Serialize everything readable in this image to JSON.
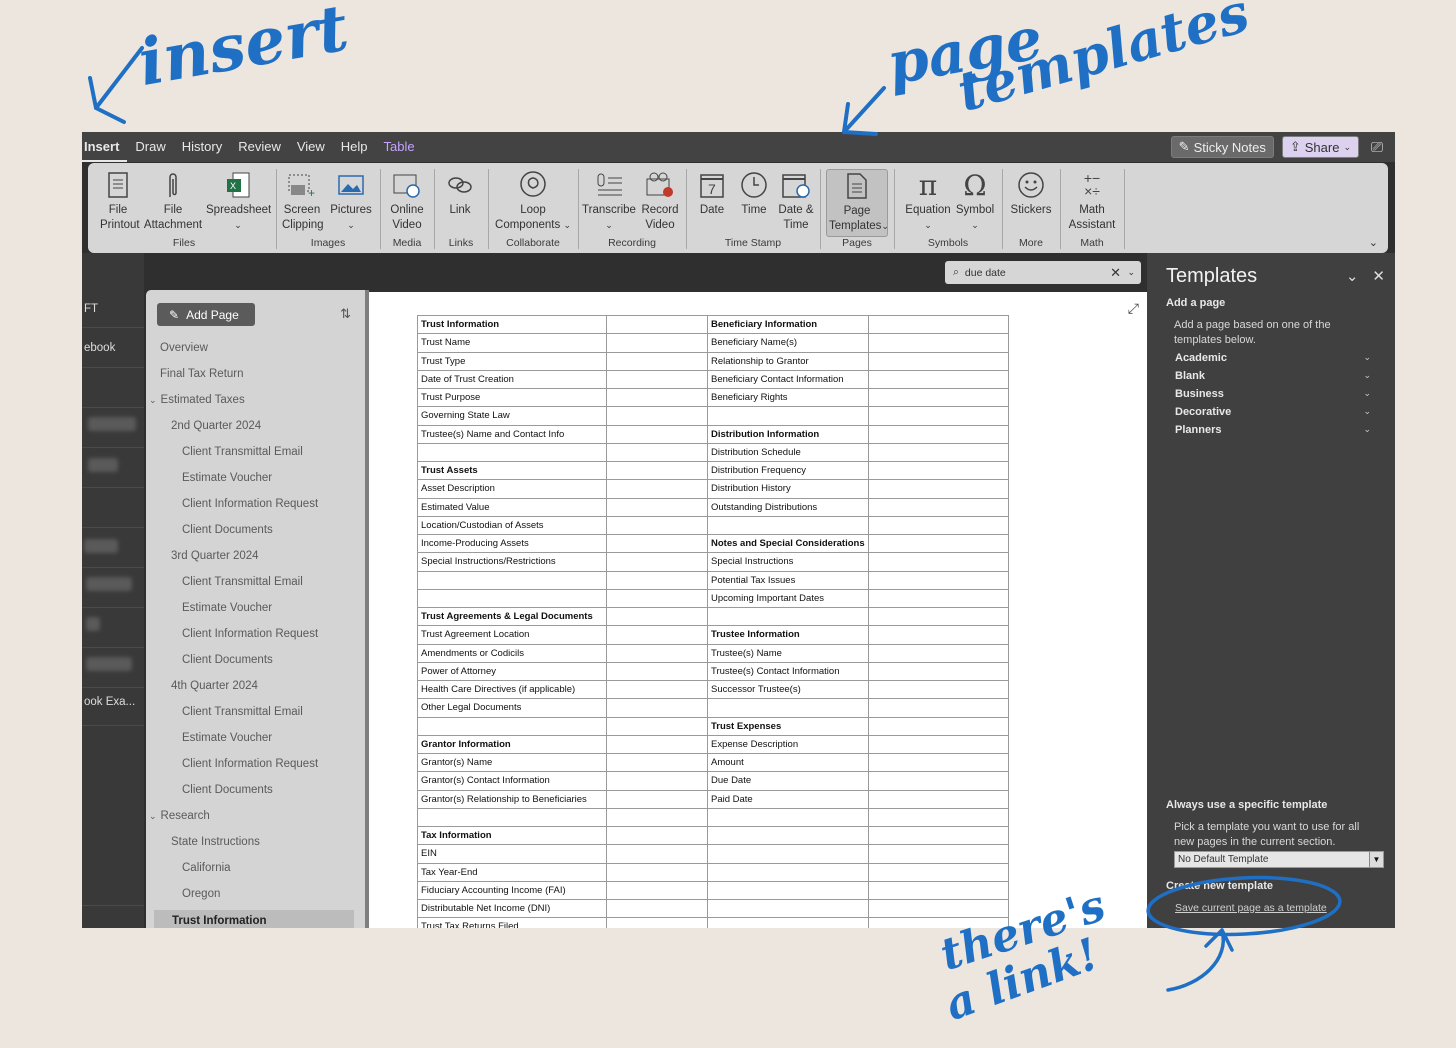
{
  "annotations": {
    "insert": "insert",
    "page_templates_1": "page",
    "page_templates_2": "templates",
    "link_1": "there's",
    "link_2": "a link!"
  },
  "tabs": [
    "Insert",
    "Draw",
    "History",
    "Review",
    "View",
    "Help",
    "Table"
  ],
  "tabs_right": {
    "sticky_notes": "Sticky Notes",
    "share": "Share"
  },
  "ribbon": {
    "groups": {
      "files": "Files",
      "images": "Images",
      "media": "Media",
      "links": "Links",
      "collaborate": "Collaborate",
      "recording": "Recording",
      "time_stamp": "Time Stamp",
      "pages": "Pages",
      "symbols": "Symbols",
      "more": "More",
      "math": "Math"
    },
    "buttons": {
      "file_printout_1": "File",
      "file_printout_2": "Printout",
      "file_attachment_1": "File",
      "file_attachment_2": "Attachment",
      "spreadsheet": "Spreadsheet",
      "screen_clipping_1": "Screen",
      "screen_clipping_2": "Clipping",
      "pictures": "Pictures",
      "online_video_1": "Online",
      "online_video_2": "Video",
      "link": "Link",
      "loop_1": "Loop",
      "loop_2": "Components",
      "transcribe": "Transcribe",
      "record_video_1": "Record",
      "record_video_2": "Video",
      "date": "Date",
      "time": "Time",
      "date_time_1": "Date &",
      "date_time_2": "Time",
      "page_templates_1": "Page",
      "page_templates_2": "Templates",
      "equation": "Equation",
      "symbol": "Symbol",
      "stickers": "Stickers",
      "math_1": "Math",
      "math_2": "Assistant"
    }
  },
  "notebooks": [
    "FT",
    "ebook",
    "ook Exa..."
  ],
  "pagelist": {
    "add_page": "Add Page",
    "pages": [
      {
        "label": "Overview",
        "level": 0
      },
      {
        "label": "Final Tax Return",
        "level": 0
      },
      {
        "label": "Estimated Taxes",
        "level": 0,
        "expanded": true
      },
      {
        "label": "2nd Quarter 2024",
        "level": 1
      },
      {
        "label": "Client Transmittal Email",
        "level": 2
      },
      {
        "label": "Estimate Voucher",
        "level": 2
      },
      {
        "label": "Client Information Request",
        "level": 2
      },
      {
        "label": "Client Documents",
        "level": 2
      },
      {
        "label": "3rd Quarter 2024",
        "level": 1
      },
      {
        "label": "Client Transmittal Email",
        "level": 2
      },
      {
        "label": "Estimate Voucher",
        "level": 2
      },
      {
        "label": "Client Information Request",
        "level": 2
      },
      {
        "label": "Client Documents",
        "level": 2
      },
      {
        "label": "4th Quarter 2024",
        "level": 1
      },
      {
        "label": "Client Transmittal Email",
        "level": 2
      },
      {
        "label": "Estimate Voucher",
        "level": 2
      },
      {
        "label": "Client Information Request",
        "level": 2
      },
      {
        "label": "Client Documents",
        "level": 2
      },
      {
        "label": "Research",
        "level": 0,
        "expanded": true
      },
      {
        "label": "State Instructions",
        "level": 1
      },
      {
        "label": "California",
        "level": 2
      },
      {
        "label": "Oregon",
        "level": 2
      },
      {
        "label": "Trust Information",
        "level": 0,
        "selected": true
      }
    ]
  },
  "search": {
    "value": "due date"
  },
  "table": {
    "rows": [
      [
        "Trust Information",
        "Beneficiary Information"
      ],
      [
        "Trust Name",
        "Beneficiary Name(s)"
      ],
      [
        "Trust Type",
        "Relationship to Grantor"
      ],
      [
        "Date of Trust Creation",
        "Beneficiary Contact Information"
      ],
      [
        "Trust Purpose",
        "Beneficiary Rights"
      ],
      [
        "Governing State Law",
        ""
      ],
      [
        "Trustee(s) Name and Contact Info",
        "Distribution Information"
      ],
      [
        "",
        "Distribution Schedule"
      ],
      [
        "Trust Assets",
        "Distribution Frequency"
      ],
      [
        "Asset Description",
        "Distribution History"
      ],
      [
        "Estimated Value",
        "Outstanding Distributions"
      ],
      [
        "Location/Custodian of Assets",
        ""
      ],
      [
        "Income-Producing Assets",
        "Notes and Special Considerations"
      ],
      [
        "Special Instructions/Restrictions",
        "Special Instructions"
      ],
      [
        "",
        "Potential Tax Issues"
      ],
      [
        "",
        "Upcoming Important Dates"
      ],
      [
        "Trust Agreements & Legal Documents",
        ""
      ],
      [
        "Trust Agreement Location",
        "Trustee Information"
      ],
      [
        "Amendments or Codicils",
        "Trustee(s) Name"
      ],
      [
        "Power of Attorney",
        "Trustee(s) Contact Information"
      ],
      [
        "Health Care Directives (if applicable)",
        "Successor Trustee(s)"
      ],
      [
        "Other Legal Documents",
        ""
      ],
      [
        "",
        "Trust Expenses"
      ],
      [
        "Grantor Information",
        "Expense Description"
      ],
      [
        "Grantor(s) Name",
        "Amount"
      ],
      [
        "Grantor(s) Contact Information",
        "Due Date"
      ],
      [
        "Grantor(s) Relationship to Beneficiaries",
        "Paid Date"
      ],
      [
        "",
        ""
      ],
      [
        "Tax Information",
        ""
      ],
      [
        "EIN",
        ""
      ],
      [
        "Tax Year-End",
        ""
      ],
      [
        "Fiduciary Accounting Income (FAI)",
        ""
      ],
      [
        "Distributable Net Income (DNI)",
        ""
      ],
      [
        "Trust Tax Returns Filed",
        ""
      ]
    ],
    "bold": [
      "Trust Information",
      "Beneficiary Information",
      "Distribution Information",
      "Trust Assets",
      "Notes and Special Considerations",
      "Trust Agreements & Legal Documents",
      "Trustee Information",
      "Trust Expenses",
      "Grantor Information",
      "Tax Information"
    ]
  },
  "templates_pane": {
    "title": "Templates",
    "add_a_page": "Add a page",
    "add_desc": "Add a page based on one of the templates below.",
    "categories": [
      "Academic",
      "Blank",
      "Business",
      "Decorative",
      "Planners"
    ],
    "always_use": "Always use a specific template",
    "always_desc": "Pick a template you want to use for all new pages in the current section.",
    "select_value": "No Default Template",
    "create_new": "Create new template",
    "save_link": "Save current page as a template"
  },
  "colors": {
    "annotation": "#1f6fc4",
    "background": "#ede6df",
    "ribbon": "#d6d6d6",
    "table_tab": "#c8a2ff"
  }
}
